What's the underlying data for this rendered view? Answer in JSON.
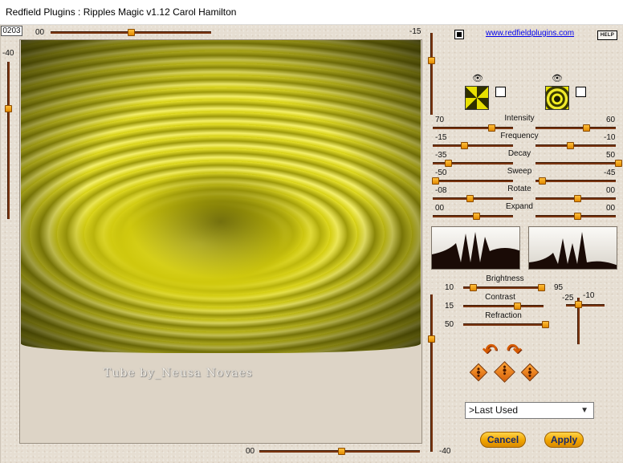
{
  "window": {
    "title": "Redfield Plugins : Ripples Magic v1.12   Carol Hamilton"
  },
  "counter": "0203",
  "top_slider": {
    "left_value": "00",
    "right_value": "-15",
    "level": 0.5
  },
  "left_slider": {
    "value": "-40"
  },
  "bottom_slider": {
    "left_value": "00",
    "right_value": "-40"
  },
  "link": "www.redfieldplugins.com",
  "help": "HELP",
  "watermark": "Tube by_Neusa Novaes",
  "params": [
    {
      "label": "Intensity",
      "left": "70",
      "right": "60"
    },
    {
      "label": "Frequency",
      "left": "-15",
      "right": "-10"
    },
    {
      "label": "Decay",
      "left": "-35",
      "right": "50"
    },
    {
      "label": "Sweep",
      "left": "-50",
      "right": "-45"
    },
    {
      "label": "Rotate",
      "left": "-08",
      "right": "00"
    },
    {
      "label": "Expand",
      "left": "00",
      "right": "00"
    }
  ],
  "lighting": [
    {
      "label": "Brightness",
      "left": "10",
      "right": "95"
    },
    {
      "label": "Contrast",
      "left": "15"
    },
    {
      "label": "Refraction",
      "left": "50"
    }
  ],
  "light_dir": {
    "x": "-25",
    "y": "-10"
  },
  "preset": {
    "selected": ">Last Used"
  },
  "buttons": {
    "cancel": "Cancel",
    "apply": "Apply"
  }
}
